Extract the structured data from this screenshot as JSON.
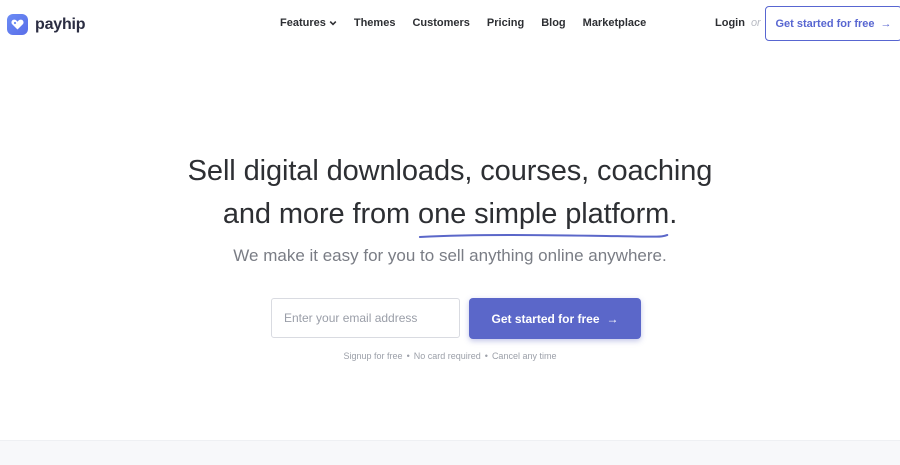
{
  "brand": {
    "name": "payhip",
    "accent_color": "#5b67c9"
  },
  "nav": {
    "items": [
      {
        "label": "Features",
        "has_dropdown": true
      },
      {
        "label": "Themes"
      },
      {
        "label": "Customers"
      },
      {
        "label": "Pricing"
      },
      {
        "label": "Blog"
      },
      {
        "label": "Marketplace"
      }
    ],
    "login_label": "Login",
    "or_label": "or",
    "cta_label": "Get started for free",
    "cta_arrow": "→"
  },
  "hero": {
    "title_line1": "Sell digital downloads, courses, coaching",
    "title_line2_prefix": "and more from ",
    "title_line2_highlight": "one simple platform",
    "title_line2_suffix": ".",
    "subtitle": "We make it easy for you to sell anything online anywhere.",
    "email_placeholder": "Enter your email address",
    "cta_label": "Get started for free",
    "cta_arrow": "→",
    "fineprint": [
      "Signup for free",
      "No card required",
      "Cancel any time"
    ],
    "fineprint_separator": "•"
  }
}
